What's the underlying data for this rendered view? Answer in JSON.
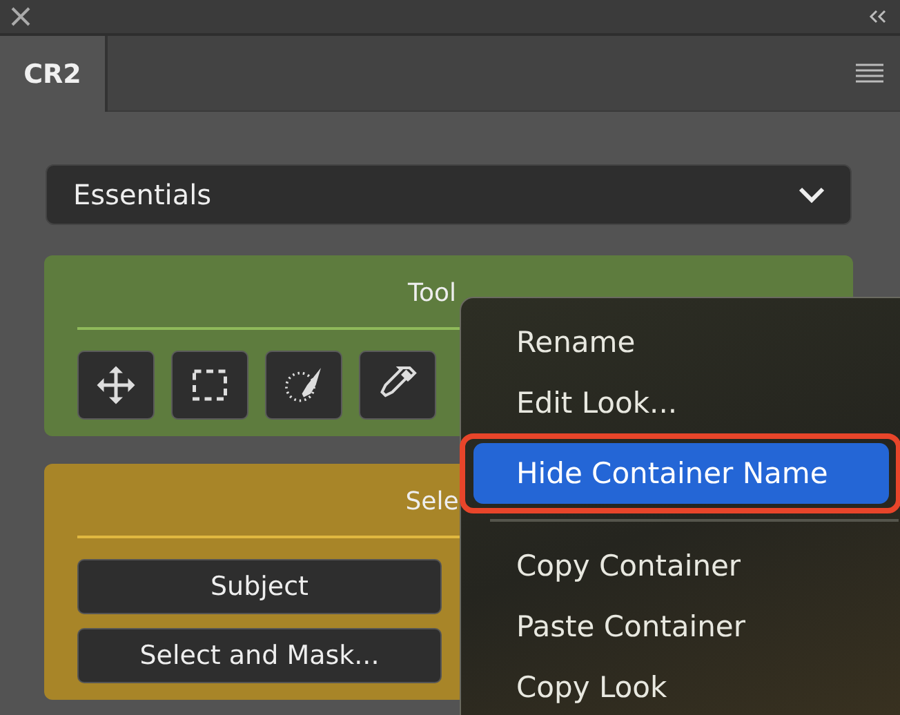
{
  "tabs": [
    {
      "label": "CR2",
      "selected": true
    }
  ],
  "workspace_dropdown": {
    "value": "Essentials"
  },
  "containers": [
    {
      "title": "Tool",
      "kind": "tools",
      "color": "#5e7c3e"
    },
    {
      "title": "Sele",
      "kind": "buttons",
      "color": "#a88528",
      "buttons": [
        "Subject",
        "Select and Mask..."
      ]
    }
  ],
  "context_menu": {
    "items": [
      {
        "kind": "item",
        "label": "Rename",
        "selected": false,
        "annotated": false
      },
      {
        "kind": "item",
        "label": "Edit Look...",
        "selected": false,
        "annotated": false
      },
      {
        "kind": "item",
        "label": "Hide Container Name",
        "selected": true,
        "annotated": true
      },
      {
        "kind": "separator"
      },
      {
        "kind": "item",
        "label": "Copy Container",
        "selected": false,
        "annotated": false
      },
      {
        "kind": "item",
        "label": "Paste Container",
        "selected": false,
        "annotated": false
      },
      {
        "kind": "item",
        "label": "Copy Look",
        "selected": false,
        "annotated": false
      }
    ]
  }
}
